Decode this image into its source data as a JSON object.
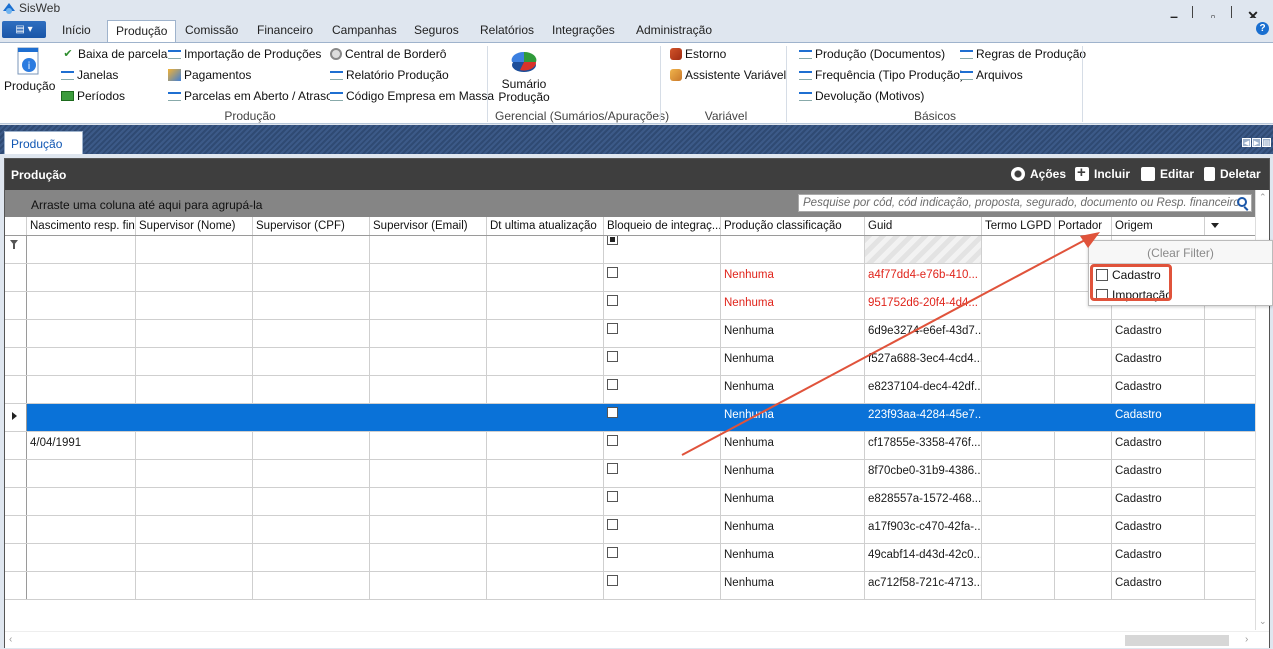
{
  "window": {
    "title": "SisWeb",
    "minimize_icon": "minimize-icon",
    "restore_icon": "restore-icon",
    "close_icon": "close-icon"
  },
  "menu": {
    "tabs": [
      "Início",
      "Produção",
      "Comissão",
      "Financeiro",
      "Campanhas",
      "Seguros",
      "Relatórios",
      "Integrações",
      "Administração"
    ],
    "active": "Produção"
  },
  "ribbon": {
    "producao_big": "Produção",
    "col1": [
      "Baixa de parcelas",
      "Janelas",
      "Períodos"
    ],
    "col2": [
      "Importação de Produções",
      "Pagamentos",
      "Parcelas em Aberto / Atraso"
    ],
    "col3": [
      "Central de Borderô",
      "Relatório Produção",
      "Código Empresa em Massa"
    ],
    "group1_label": "Produção",
    "sumario_line1": "Sumário",
    "sumario_line2": "Produção",
    "group2_label": "Gerencial (Sumários/Apurações)",
    "variavel_items": [
      "Estorno",
      "Assistente Variável"
    ],
    "group3_label": "Variável",
    "basicos_col1": [
      "Produção (Documentos)",
      "Frequência (Tipo Produção)",
      "Devolução (Motivos)"
    ],
    "basicos_col2": [
      "Regras de Produção",
      "Arquivos"
    ],
    "group4_label": "Básicos"
  },
  "doc_tab": "Produção",
  "panel": {
    "title": "Produção",
    "actions": [
      "Ações",
      "Incluir",
      "Editar",
      "Deletar"
    ],
    "group_hint": "Arraste uma coluna até aqui para agrupá-la",
    "search_placeholder": "Pesquise por cód, cód indicação, proposta, segurado, documento ou Resp. financeiro"
  },
  "grid": {
    "columns": [
      "Nascimento resp. fin...",
      "Supervisor (Nome)",
      "Supervisor (CPF)",
      "Supervisor (Email)",
      "Dt ultima atualização",
      "Bloqueio de integraç...",
      "Produção classificação",
      "Guid",
      "Termo LGPD",
      "Portador",
      "Origem"
    ],
    "rows": [
      {
        "nasc": "",
        "classificacao": "Nenhuma",
        "guid": "a4f77dd4-e76b-410...",
        "origem": "Cadastro",
        "highlight": true
      },
      {
        "nasc": "",
        "classificacao": "Nenhuma",
        "guid": "951752d6-20f4-4d4...",
        "origem": "Cadastro",
        "highlight": true
      },
      {
        "nasc": "",
        "classificacao": "Nenhuma",
        "guid": "6d9e3274-e6ef-43d7...",
        "origem": "Cadastro",
        "highlight": false
      },
      {
        "nasc": "",
        "classificacao": "Nenhuma",
        "guid": "f527a688-3ec4-4cd4...",
        "origem": "Cadastro",
        "highlight": false
      },
      {
        "nasc": "",
        "classificacao": "Nenhuma",
        "guid": "e8237104-dec4-42df...",
        "origem": "Cadastro",
        "highlight": false
      },
      {
        "nasc": "",
        "classificacao": "Nenhuma",
        "guid": "223f93aa-4284-45e7...",
        "origem": "Cadastro",
        "highlight": false,
        "selected": true
      },
      {
        "nasc": "4/04/1991",
        "classificacao": "Nenhuma",
        "guid": "cf17855e-3358-476f...",
        "origem": "Cadastro",
        "highlight": false
      },
      {
        "nasc": "",
        "classificacao": "Nenhuma",
        "guid": "8f70cbe0-31b9-4386...",
        "origem": "Cadastro",
        "highlight": false
      },
      {
        "nasc": "",
        "classificacao": "Nenhuma",
        "guid": "e828557a-1572-468...",
        "origem": "Cadastro",
        "highlight": false
      },
      {
        "nasc": "",
        "classificacao": "Nenhuma",
        "guid": "a17f903c-c470-42fa-...",
        "origem": "Cadastro",
        "highlight": false
      },
      {
        "nasc": "",
        "classificacao": "Nenhuma",
        "guid": "49cabf14-d43d-42c0...",
        "origem": "Cadastro",
        "highlight": false
      },
      {
        "nasc": "",
        "classificacao": "Nenhuma",
        "guid": "ac712f58-721c-4713...",
        "origem": "Cadastro",
        "highlight": false
      }
    ]
  },
  "origem_filter": {
    "clear_label": "(Clear Filter)",
    "options": [
      "Cadastro",
      "Importação"
    ]
  },
  "colors": {
    "selection": "#0a72d8",
    "highlight_text": "#e0241b",
    "annotation": "#e0533b",
    "panel_header": "#3e3e3e"
  }
}
